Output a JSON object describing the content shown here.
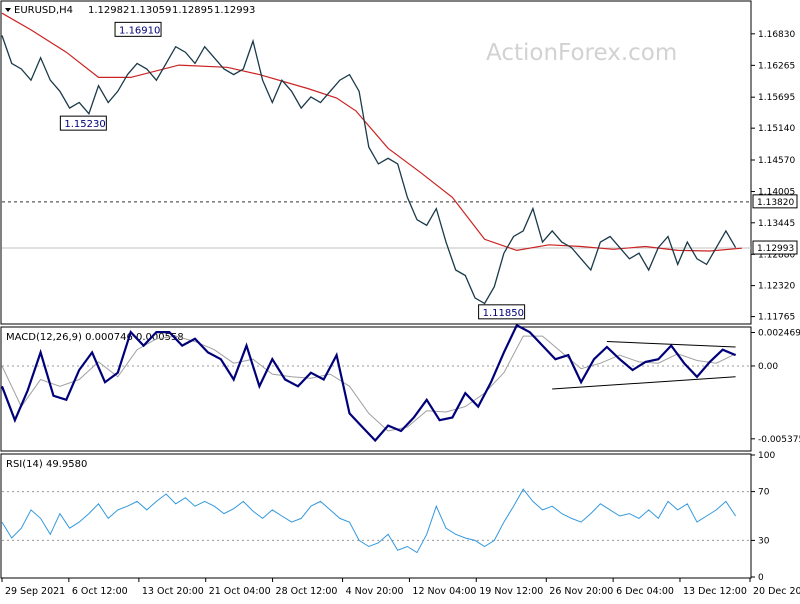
{
  "chart_data": [
    {
      "panel": "price",
      "type": "line",
      "title": "EURUSD,H4",
      "ohlc": [
        "1.12982",
        "1.13059",
        "1.12895",
        "1.12993"
      ],
      "watermark": "ActionForex.com",
      "ylim": [
        1.1165,
        1.174
      ],
      "ticks": [
        "1.16830",
        "1.16265",
        "1.15695",
        "1.15140",
        "1.14570",
        "1.14005",
        "1.13445",
        "1.12880",
        "1.12320",
        "1.11765"
      ],
      "tick_values": [
        1.1683,
        1.16265,
        1.15695,
        1.1514,
        1.1457,
        1.14005,
        1.13445,
        1.1288,
        1.1232,
        1.11765
      ],
      "hline": {
        "label": "1.13820",
        "value": 1.1382
      },
      "current": {
        "label": "1.12993",
        "value": 1.12993
      },
      "annotations": [
        {
          "label": "1.16910",
          "x": 37,
          "y": 1.1691
        },
        {
          "label": "1.15230",
          "x": 20,
          "y": 1.1523
        },
        {
          "label": "1.11850",
          "x": 150,
          "y": 1.1185
        }
      ],
      "x_range": [
        0,
        230
      ],
      "close": [
        [
          0,
          1.168
        ],
        [
          3,
          1.163
        ],
        [
          6,
          1.162
        ],
        [
          9,
          1.16
        ],
        [
          12,
          1.164
        ],
        [
          15,
          1.16
        ],
        [
          18,
          1.158
        ],
        [
          21,
          1.155
        ],
        [
          24,
          1.156
        ],
        [
          27,
          1.154
        ],
        [
          30,
          1.159
        ],
        [
          33,
          1.156
        ],
        [
          36,
          1.158
        ],
        [
          39,
          1.161
        ],
        [
          42,
          1.163
        ],
        [
          45,
          1.162
        ],
        [
          48,
          1.16
        ],
        [
          51,
          1.163
        ],
        [
          54,
          1.166
        ],
        [
          57,
          1.165
        ],
        [
          60,
          1.163
        ],
        [
          63,
          1.166
        ],
        [
          66,
          1.164
        ],
        [
          69,
          1.162
        ],
        [
          72,
          1.161
        ],
        [
          75,
          1.162
        ],
        [
          78,
          1.167
        ],
        [
          81,
          1.16
        ],
        [
          84,
          1.156
        ],
        [
          87,
          1.16
        ],
        [
          90,
          1.158
        ],
        [
          93,
          1.155
        ],
        [
          96,
          1.157
        ],
        [
          99,
          1.156
        ],
        [
          102,
          1.158
        ],
        [
          105,
          1.16
        ],
        [
          108,
          1.161
        ],
        [
          111,
          1.158
        ],
        [
          114,
          1.148
        ],
        [
          117,
          1.145
        ],
        [
          120,
          1.146
        ],
        [
          123,
          1.145
        ],
        [
          126,
          1.139
        ],
        [
          129,
          1.135
        ],
        [
          132,
          1.134
        ],
        [
          135,
          1.137
        ],
        [
          138,
          1.131
        ],
        [
          141,
          1.126
        ],
        [
          144,
          1.125
        ],
        [
          147,
          1.121
        ],
        [
          150,
          1.12
        ],
        [
          153,
          1.123
        ],
        [
          156,
          1.129
        ],
        [
          159,
          1.132
        ],
        [
          162,
          1.133
        ],
        [
          165,
          1.137
        ],
        [
          168,
          1.131
        ],
        [
          171,
          1.133
        ],
        [
          174,
          1.131
        ],
        [
          177,
          1.13
        ],
        [
          180,
          1.128
        ],
        [
          183,
          1.126
        ],
        [
          186,
          1.131
        ],
        [
          189,
          1.132
        ],
        [
          192,
          1.13
        ],
        [
          195,
          1.128
        ],
        [
          198,
          1.129
        ],
        [
          201,
          1.126
        ],
        [
          204,
          1.13
        ],
        [
          207,
          1.132
        ],
        [
          210,
          1.127
        ],
        [
          213,
          1.131
        ],
        [
          216,
          1.128
        ],
        [
          219,
          1.127
        ],
        [
          222,
          1.13
        ],
        [
          225,
          1.133
        ],
        [
          228,
          1.13
        ]
      ],
      "ma": [
        [
          0,
          1.172
        ],
        [
          9,
          1.169
        ],
        [
          20,
          1.165
        ],
        [
          30,
          1.1605
        ],
        [
          40,
          1.1605
        ],
        [
          55,
          1.1627
        ],
        [
          70,
          1.1623
        ],
        [
          80,
          1.161
        ],
        [
          95,
          1.1585
        ],
        [
          104,
          1.1568
        ],
        [
          110,
          1.1545
        ],
        [
          120,
          1.1478
        ],
        [
          130,
          1.1435
        ],
        [
          140,
          1.139
        ],
        [
          150,
          1.1315
        ],
        [
          160,
          1.1295
        ],
        [
          170,
          1.1305
        ],
        [
          180,
          1.1302
        ],
        [
          190,
          1.1297
        ],
        [
          200,
          1.1302
        ],
        [
          210,
          1.1295
        ],
        [
          220,
          1.1294
        ],
        [
          230,
          1.1299
        ]
      ]
    },
    {
      "panel": "macd",
      "type": "line",
      "title": "MACD(12,26,9) 0.000746 0.000558",
      "ylim": [
        -0.0062,
        0.0028
      ],
      "ticks": [
        "0.002469",
        "0.00",
        "-0.005375"
      ],
      "tick_values": [
        0.002469,
        0.0,
        -0.005375
      ],
      "x_range": [
        0,
        230
      ],
      "macd": [
        [
          0,
          -0.0015
        ],
        [
          4,
          -0.004
        ],
        [
          8,
          -0.0018
        ],
        [
          12,
          0.001
        ],
        [
          16,
          -0.0022
        ],
        [
          20,
          -0.0025
        ],
        [
          24,
          -0.0003
        ],
        [
          28,
          0.001
        ],
        [
          32,
          -0.0012
        ],
        [
          36,
          -0.0005
        ],
        [
          40,
          0.0025
        ],
        [
          44,
          0.0015
        ],
        [
          48,
          0.0025
        ],
        [
          52,
          0.0025
        ],
        [
          56,
          0.0015
        ],
        [
          60,
          0.002
        ],
        [
          64,
          0.001
        ],
        [
          68,
          0.0005
        ],
        [
          72,
          -0.001
        ],
        [
          76,
          0.0015
        ],
        [
          80,
          -0.0015
        ],
        [
          84,
          0.0005
        ],
        [
          88,
          -0.001
        ],
        [
          92,
          -0.0015
        ],
        [
          96,
          -0.0005
        ],
        [
          100,
          -0.001
        ],
        [
          104,
          0.0008
        ],
        [
          108,
          -0.0035
        ],
        [
          112,
          -0.0045
        ],
        [
          116,
          -0.0055
        ],
        [
          120,
          -0.0044
        ],
        [
          124,
          -0.0048
        ],
        [
          128,
          -0.0038
        ],
        [
          132,
          -0.0025
        ],
        [
          136,
          -0.004
        ],
        [
          140,
          -0.0038
        ],
        [
          144,
          -0.002
        ],
        [
          148,
          -0.003
        ],
        [
          152,
          -0.0012
        ],
        [
          156,
          0.001
        ],
        [
          160,
          0.003
        ],
        [
          164,
          0.0025
        ],
        [
          168,
          0.0015
        ],
        [
          172,
          0.0005
        ],
        [
          176,
          0.0008
        ],
        [
          180,
          -0.0012
        ],
        [
          184,
          0.0005
        ],
        [
          188,
          0.0014
        ],
        [
          192,
          0.0005
        ],
        [
          196,
          -0.0003
        ],
        [
          200,
          0.0003
        ],
        [
          204,
          0.0005
        ],
        [
          208,
          0.0015
        ],
        [
          212,
          0.0002
        ],
        [
          216,
          -0.0008
        ],
        [
          220,
          0.0003
        ],
        [
          224,
          0.0012
        ],
        [
          228,
          0.0008
        ]
      ],
      "signal": [
        [
          0,
          0.0
        ],
        [
          6,
          -0.003
        ],
        [
          12,
          -0.001
        ],
        [
          18,
          -0.0015
        ],
        [
          24,
          -0.001
        ],
        [
          30,
          0.0003
        ],
        [
          36,
          -0.0008
        ],
        [
          42,
          0.0012
        ],
        [
          48,
          0.002
        ],
        [
          54,
          0.0022
        ],
        [
          60,
          0.0018
        ],
        [
          66,
          0.0012
        ],
        [
          72,
          0.0002
        ],
        [
          78,
          0.0005
        ],
        [
          84,
          -0.0006
        ],
        [
          90,
          -0.0008
        ],
        [
          96,
          -0.0009
        ],
        [
          102,
          -0.0006
        ],
        [
          108,
          -0.0015
        ],
        [
          114,
          -0.0035
        ],
        [
          120,
          -0.0048
        ],
        [
          126,
          -0.0045
        ],
        [
          132,
          -0.0033
        ],
        [
          138,
          -0.0034
        ],
        [
          144,
          -0.003
        ],
        [
          150,
          -0.002
        ],
        [
          156,
          -0.0005
        ],
        [
          162,
          0.0022
        ],
        [
          168,
          0.0022
        ],
        [
          174,
          0.001
        ],
        [
          180,
          -0.0002
        ],
        [
          186,
          0.0002
        ],
        [
          192,
          0.0008
        ],
        [
          198,
          0.0003
        ],
        [
          204,
          0.0002
        ],
        [
          210,
          0.0009
        ],
        [
          216,
          0.0004
        ],
        [
          222,
          0.0002
        ],
        [
          228,
          0.0009
        ]
      ],
      "trendlines": [
        {
          "x0": 188,
          "y0": 0.0018,
          "x1": 228,
          "y1": 0.0014
        },
        {
          "x0": 171,
          "y0": -0.0017,
          "x1": 228,
          "y1": -0.0008
        }
      ]
    },
    {
      "panel": "rsi",
      "type": "line",
      "title": "RSI(14) 49.9580",
      "ylim": [
        0,
        100
      ],
      "ticks": [
        "100",
        "70",
        "30",
        "0"
      ],
      "tick_values": [
        100,
        70,
        30,
        0
      ],
      "x_range": [
        0,
        230
      ],
      "rsi": [
        [
          0,
          45
        ],
        [
          3,
          32
        ],
        [
          6,
          40
        ],
        [
          9,
          55
        ],
        [
          12,
          48
        ],
        [
          15,
          35
        ],
        [
          18,
          52
        ],
        [
          21,
          40
        ],
        [
          24,
          45
        ],
        [
          27,
          52
        ],
        [
          30,
          60
        ],
        [
          33,
          48
        ],
        [
          36,
          55
        ],
        [
          39,
          58
        ],
        [
          42,
          62
        ],
        [
          45,
          55
        ],
        [
          48,
          62
        ],
        [
          51,
          68
        ],
        [
          54,
          60
        ],
        [
          57,
          65
        ],
        [
          60,
          58
        ],
        [
          63,
          62
        ],
        [
          66,
          58
        ],
        [
          69,
          52
        ],
        [
          72,
          56
        ],
        [
          75,
          62
        ],
        [
          78,
          54
        ],
        [
          81,
          48
        ],
        [
          84,
          55
        ],
        [
          87,
          50
        ],
        [
          90,
          45
        ],
        [
          93,
          48
        ],
        [
          96,
          58
        ],
        [
          99,
          62
        ],
        [
          102,
          55
        ],
        [
          105,
          48
        ],
        [
          108,
          45
        ],
        [
          111,
          30
        ],
        [
          114,
          25
        ],
        [
          117,
          28
        ],
        [
          120,
          35
        ],
        [
          123,
          22
        ],
        [
          126,
          25
        ],
        [
          129,
          20
        ],
        [
          132,
          35
        ],
        [
          135,
          58
        ],
        [
          138,
          40
        ],
        [
          141,
          35
        ],
        [
          144,
          32
        ],
        [
          147,
          30
        ],
        [
          150,
          25
        ],
        [
          153,
          30
        ],
        [
          156,
          45
        ],
        [
          159,
          58
        ],
        [
          162,
          72
        ],
        [
          165,
          62
        ],
        [
          168,
          55
        ],
        [
          171,
          58
        ],
        [
          174,
          52
        ],
        [
          177,
          48
        ],
        [
          180,
          45
        ],
        [
          183,
          52
        ],
        [
          186,
          60
        ],
        [
          189,
          55
        ],
        [
          192,
          50
        ],
        [
          195,
          52
        ],
        [
          198,
          48
        ],
        [
          201,
          55
        ],
        [
          204,
          48
        ],
        [
          207,
          62
        ],
        [
          210,
          55
        ],
        [
          213,
          60
        ],
        [
          216,
          45
        ],
        [
          219,
          50
        ],
        [
          222,
          55
        ],
        [
          225,
          62
        ],
        [
          228,
          50
        ]
      ]
    }
  ],
  "xaxis": {
    "labels": [
      "29 Sep 2021",
      "6 Oct 12:00",
      "13 Oct 20:00",
      "21 Oct 04:00",
      "28 Oct 12:00",
      "4 Nov 20:00",
      "12 Nov 04:00",
      "19 Nov 12:00",
      "26 Nov 20:00",
      "6 Dec 04:00",
      "13 Dec 12:00",
      "20 Dec 20:00"
    ],
    "positions": [
      0,
      21,
      43,
      64,
      85,
      107,
      128,
      149,
      171,
      192,
      213,
      235
    ]
  },
  "colors": {
    "price": "#1a3a4a",
    "ma": "#cc2222",
    "macd": "#00007a",
    "signal": "#a0a0a0",
    "rsi": "#3399dd",
    "trend": "#000000",
    "grid": "#808080"
  }
}
